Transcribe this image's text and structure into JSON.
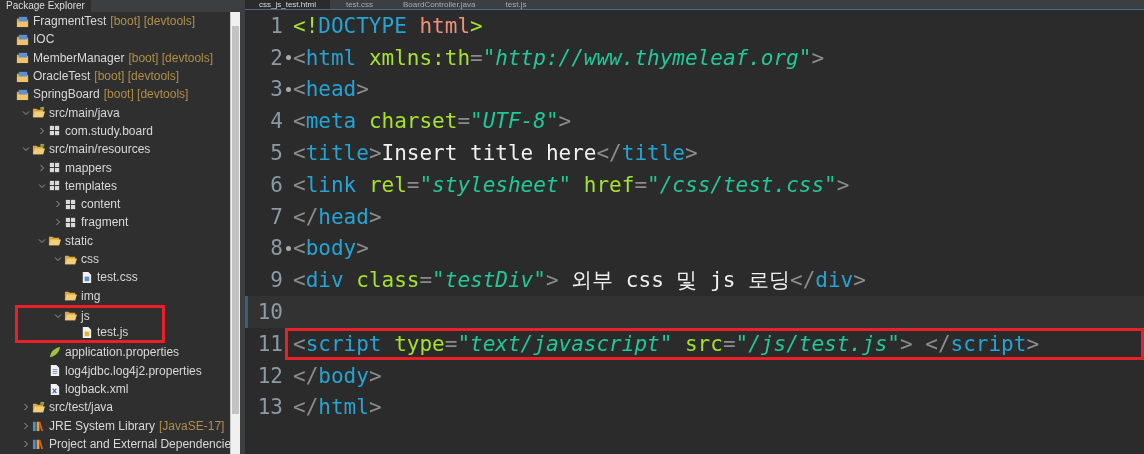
{
  "explorer": {
    "title": "Package Explorer",
    "tree": [
      {
        "label": "FragmentTest",
        "decoration": "[boot] [devtools]",
        "kind": "project",
        "highlighted": false
      },
      {
        "label": "IOC",
        "kind": "project",
        "highlighted": false
      },
      {
        "label": "MemberManager",
        "decoration": "[boot] [devtools]",
        "kind": "project",
        "highlighted": false
      },
      {
        "label": "OracleTest",
        "decoration": "[boot] [devtools]",
        "kind": "project",
        "highlighted": false
      },
      {
        "label": "SpringBoard",
        "decoration": "[boot] [devtools]",
        "kind": "project",
        "highlighted": false,
        "children": [
          {
            "label": "src/main/java",
            "kind": "source-folder",
            "expanded": true,
            "highlighted": false,
            "children": [
              {
                "label": "com.study.board",
                "kind": "package",
                "expanded": false,
                "highlighted": false
              }
            ]
          },
          {
            "label": "src/main/resources",
            "kind": "source-folder",
            "expanded": true,
            "highlighted": false,
            "children": [
              {
                "label": "mappers",
                "kind": "package",
                "expanded": false,
                "highlighted": false
              },
              {
                "label": "templates",
                "kind": "package",
                "expanded": true,
                "highlighted": false,
                "children": [
                  {
                    "label": "content",
                    "kind": "package",
                    "expanded": false,
                    "highlighted": false
                  },
                  {
                    "label": "fragment",
                    "kind": "package",
                    "expanded": false,
                    "highlighted": false
                  }
                ]
              },
              {
                "label": "static",
                "kind": "folder",
                "expanded": true,
                "highlighted": false,
                "children": [
                  {
                    "label": "css",
                    "kind": "folder",
                    "expanded": true,
                    "highlighted": false,
                    "children": [
                      {
                        "label": "test.css",
                        "kind": "file-css",
                        "highlighted": false
                      }
                    ]
                  },
                  {
                    "label": "img",
                    "kind": "folder",
                    "highlighted": false
                  },
                  {
                    "label": "js",
                    "kind": "folder",
                    "expanded": true,
                    "highlighted": true,
                    "children": [
                      {
                        "label": "test.js",
                        "kind": "file-js",
                        "highlighted": true
                      }
                    ]
                  }
                ]
              },
              {
                "label": "application.properties",
                "kind": "leaf",
                "highlighted": false
              },
              {
                "label": "log4jdbc.log4j2.properties",
                "kind": "file-text",
                "highlighted": false
              },
              {
                "label": "logback.xml",
                "kind": "file-xml",
                "highlighted": false
              }
            ]
          },
          {
            "label": "src/test/java",
            "kind": "source-folder",
            "expanded": false,
            "highlighted": false
          },
          {
            "label": "JRE System Library",
            "decoration": "[JavaSE-17]",
            "kind": "library",
            "expanded": false,
            "highlighted": false
          },
          {
            "label": "Project and External Dependencie",
            "kind": "library",
            "expanded": false,
            "highlighted": false
          }
        ]
      }
    ]
  },
  "editor": {
    "tabs": [
      {
        "label": "css_js_test.html",
        "selected": true
      },
      {
        "label": "test.css",
        "selected": false
      },
      {
        "label": "BoardController.java",
        "selected": false
      },
      {
        "label": "test.js",
        "selected": false
      }
    ],
    "lines": [
      {
        "number": "1",
        "fold": false,
        "current": false,
        "highlighted": false,
        "tokens": [
          {
            "t": "<!",
            "kind": "bracket"
          },
          {
            "t": "DOCTYPE",
            "kind": "tag"
          },
          {
            "t": " html",
            "kind": "doctype"
          },
          {
            "t": ">",
            "kind": "bracket"
          }
        ]
      },
      {
        "number": "2",
        "fold": true,
        "current": false,
        "highlighted": false,
        "tokens": [
          {
            "t": "<",
            "kind": "punct"
          },
          {
            "t": "html",
            "kind": "tag"
          },
          {
            "t": " xmlns:th",
            "kind": "attr"
          },
          {
            "t": "=",
            "kind": "punct"
          },
          {
            "t": "\"http://www.thymeleaf.org\"",
            "kind": "string"
          },
          {
            "t": ">",
            "kind": "punct"
          }
        ]
      },
      {
        "number": "3",
        "fold": true,
        "current": false,
        "highlighted": false,
        "tokens": [
          {
            "t": "<",
            "kind": "punct"
          },
          {
            "t": "head",
            "kind": "tag"
          },
          {
            "t": ">",
            "kind": "punct"
          }
        ]
      },
      {
        "number": "4",
        "fold": false,
        "current": false,
        "highlighted": false,
        "tokens": [
          {
            "t": "<",
            "kind": "punct"
          },
          {
            "t": "meta",
            "kind": "tag"
          },
          {
            "t": " charset",
            "kind": "attr"
          },
          {
            "t": "=",
            "kind": "punct"
          },
          {
            "t": "\"UTF-8\"",
            "kind": "string"
          },
          {
            "t": ">",
            "kind": "punct"
          }
        ]
      },
      {
        "number": "5",
        "fold": false,
        "current": false,
        "highlighted": false,
        "tokens": [
          {
            "t": "<",
            "kind": "punct"
          },
          {
            "t": "title",
            "kind": "tag"
          },
          {
            "t": ">",
            "kind": "punct"
          },
          {
            "t": "Insert title here",
            "kind": "text"
          },
          {
            "t": "</",
            "kind": "punct"
          },
          {
            "t": "title",
            "kind": "tag"
          },
          {
            "t": ">",
            "kind": "punct"
          }
        ]
      },
      {
        "number": "6",
        "fold": false,
        "current": false,
        "highlighted": false,
        "tokens": [
          {
            "t": "<",
            "kind": "punct"
          },
          {
            "t": "link",
            "kind": "tag"
          },
          {
            "t": " rel",
            "kind": "attr"
          },
          {
            "t": "=",
            "kind": "punct"
          },
          {
            "t": "\"stylesheet\"",
            "kind": "string"
          },
          {
            "t": " href",
            "kind": "attr"
          },
          {
            "t": "=",
            "kind": "punct"
          },
          {
            "t": "\"/css/test.css\"",
            "kind": "string"
          },
          {
            "t": ">",
            "kind": "punct"
          }
        ]
      },
      {
        "number": "7",
        "fold": false,
        "current": false,
        "highlighted": false,
        "tokens": [
          {
            "t": "</",
            "kind": "punct"
          },
          {
            "t": "head",
            "kind": "tag"
          },
          {
            "t": ">",
            "kind": "punct"
          }
        ]
      },
      {
        "number": "8",
        "fold": true,
        "current": false,
        "highlighted": false,
        "tokens": [
          {
            "t": "<",
            "kind": "punct"
          },
          {
            "t": "body",
            "kind": "tag"
          },
          {
            "t": ">",
            "kind": "punct"
          }
        ]
      },
      {
        "number": "9",
        "fold": false,
        "current": false,
        "highlighted": false,
        "tokens": [
          {
            "t": "<",
            "kind": "punct"
          },
          {
            "t": "div",
            "kind": "tag"
          },
          {
            "t": " class",
            "kind": "attr"
          },
          {
            "t": "=",
            "kind": "punct"
          },
          {
            "t": "\"testDiv\"",
            "kind": "string"
          },
          {
            "t": ">",
            "kind": "punct"
          },
          {
            "t": " 외부 css 및 js 로딩",
            "kind": "text"
          },
          {
            "t": "</",
            "kind": "punct"
          },
          {
            "t": "div",
            "kind": "tag"
          },
          {
            "t": ">",
            "kind": "punct"
          }
        ]
      },
      {
        "number": "10",
        "fold": false,
        "current": true,
        "highlighted": false
      },
      {
        "number": "11",
        "fold": false,
        "current": false,
        "highlighted": true,
        "tokens": [
          {
            "t": "<",
            "kind": "punct"
          },
          {
            "t": "script",
            "kind": "tag"
          },
          {
            "t": " type",
            "kind": "attr"
          },
          {
            "t": "=",
            "kind": "punct"
          },
          {
            "t": "\"text/javascript\"",
            "kind": "string"
          },
          {
            "t": " src",
            "kind": "attr"
          },
          {
            "t": "=",
            "kind": "punct"
          },
          {
            "t": "\"/js/test.js\"",
            "kind": "string"
          },
          {
            "t": "> ",
            "kind": "punct"
          },
          {
            "t": "</",
            "kind": "punct"
          },
          {
            "t": "script",
            "kind": "tag"
          },
          {
            "t": ">",
            "kind": "punct"
          }
        ]
      },
      {
        "number": "12",
        "fold": false,
        "current": false,
        "highlighted": false,
        "tokens": [
          {
            "t": "</",
            "kind": "punct"
          },
          {
            "t": "body",
            "kind": "tag"
          },
          {
            "t": ">",
            "kind": "punct"
          }
        ]
      },
      {
        "number": "13",
        "fold": false,
        "current": false,
        "highlighted": false,
        "tokens": [
          {
            "t": "</",
            "kind": "punct"
          },
          {
            "t": "html",
            "kind": "tag"
          },
          {
            "t": ">",
            "kind": "punct"
          }
        ]
      }
    ]
  }
}
